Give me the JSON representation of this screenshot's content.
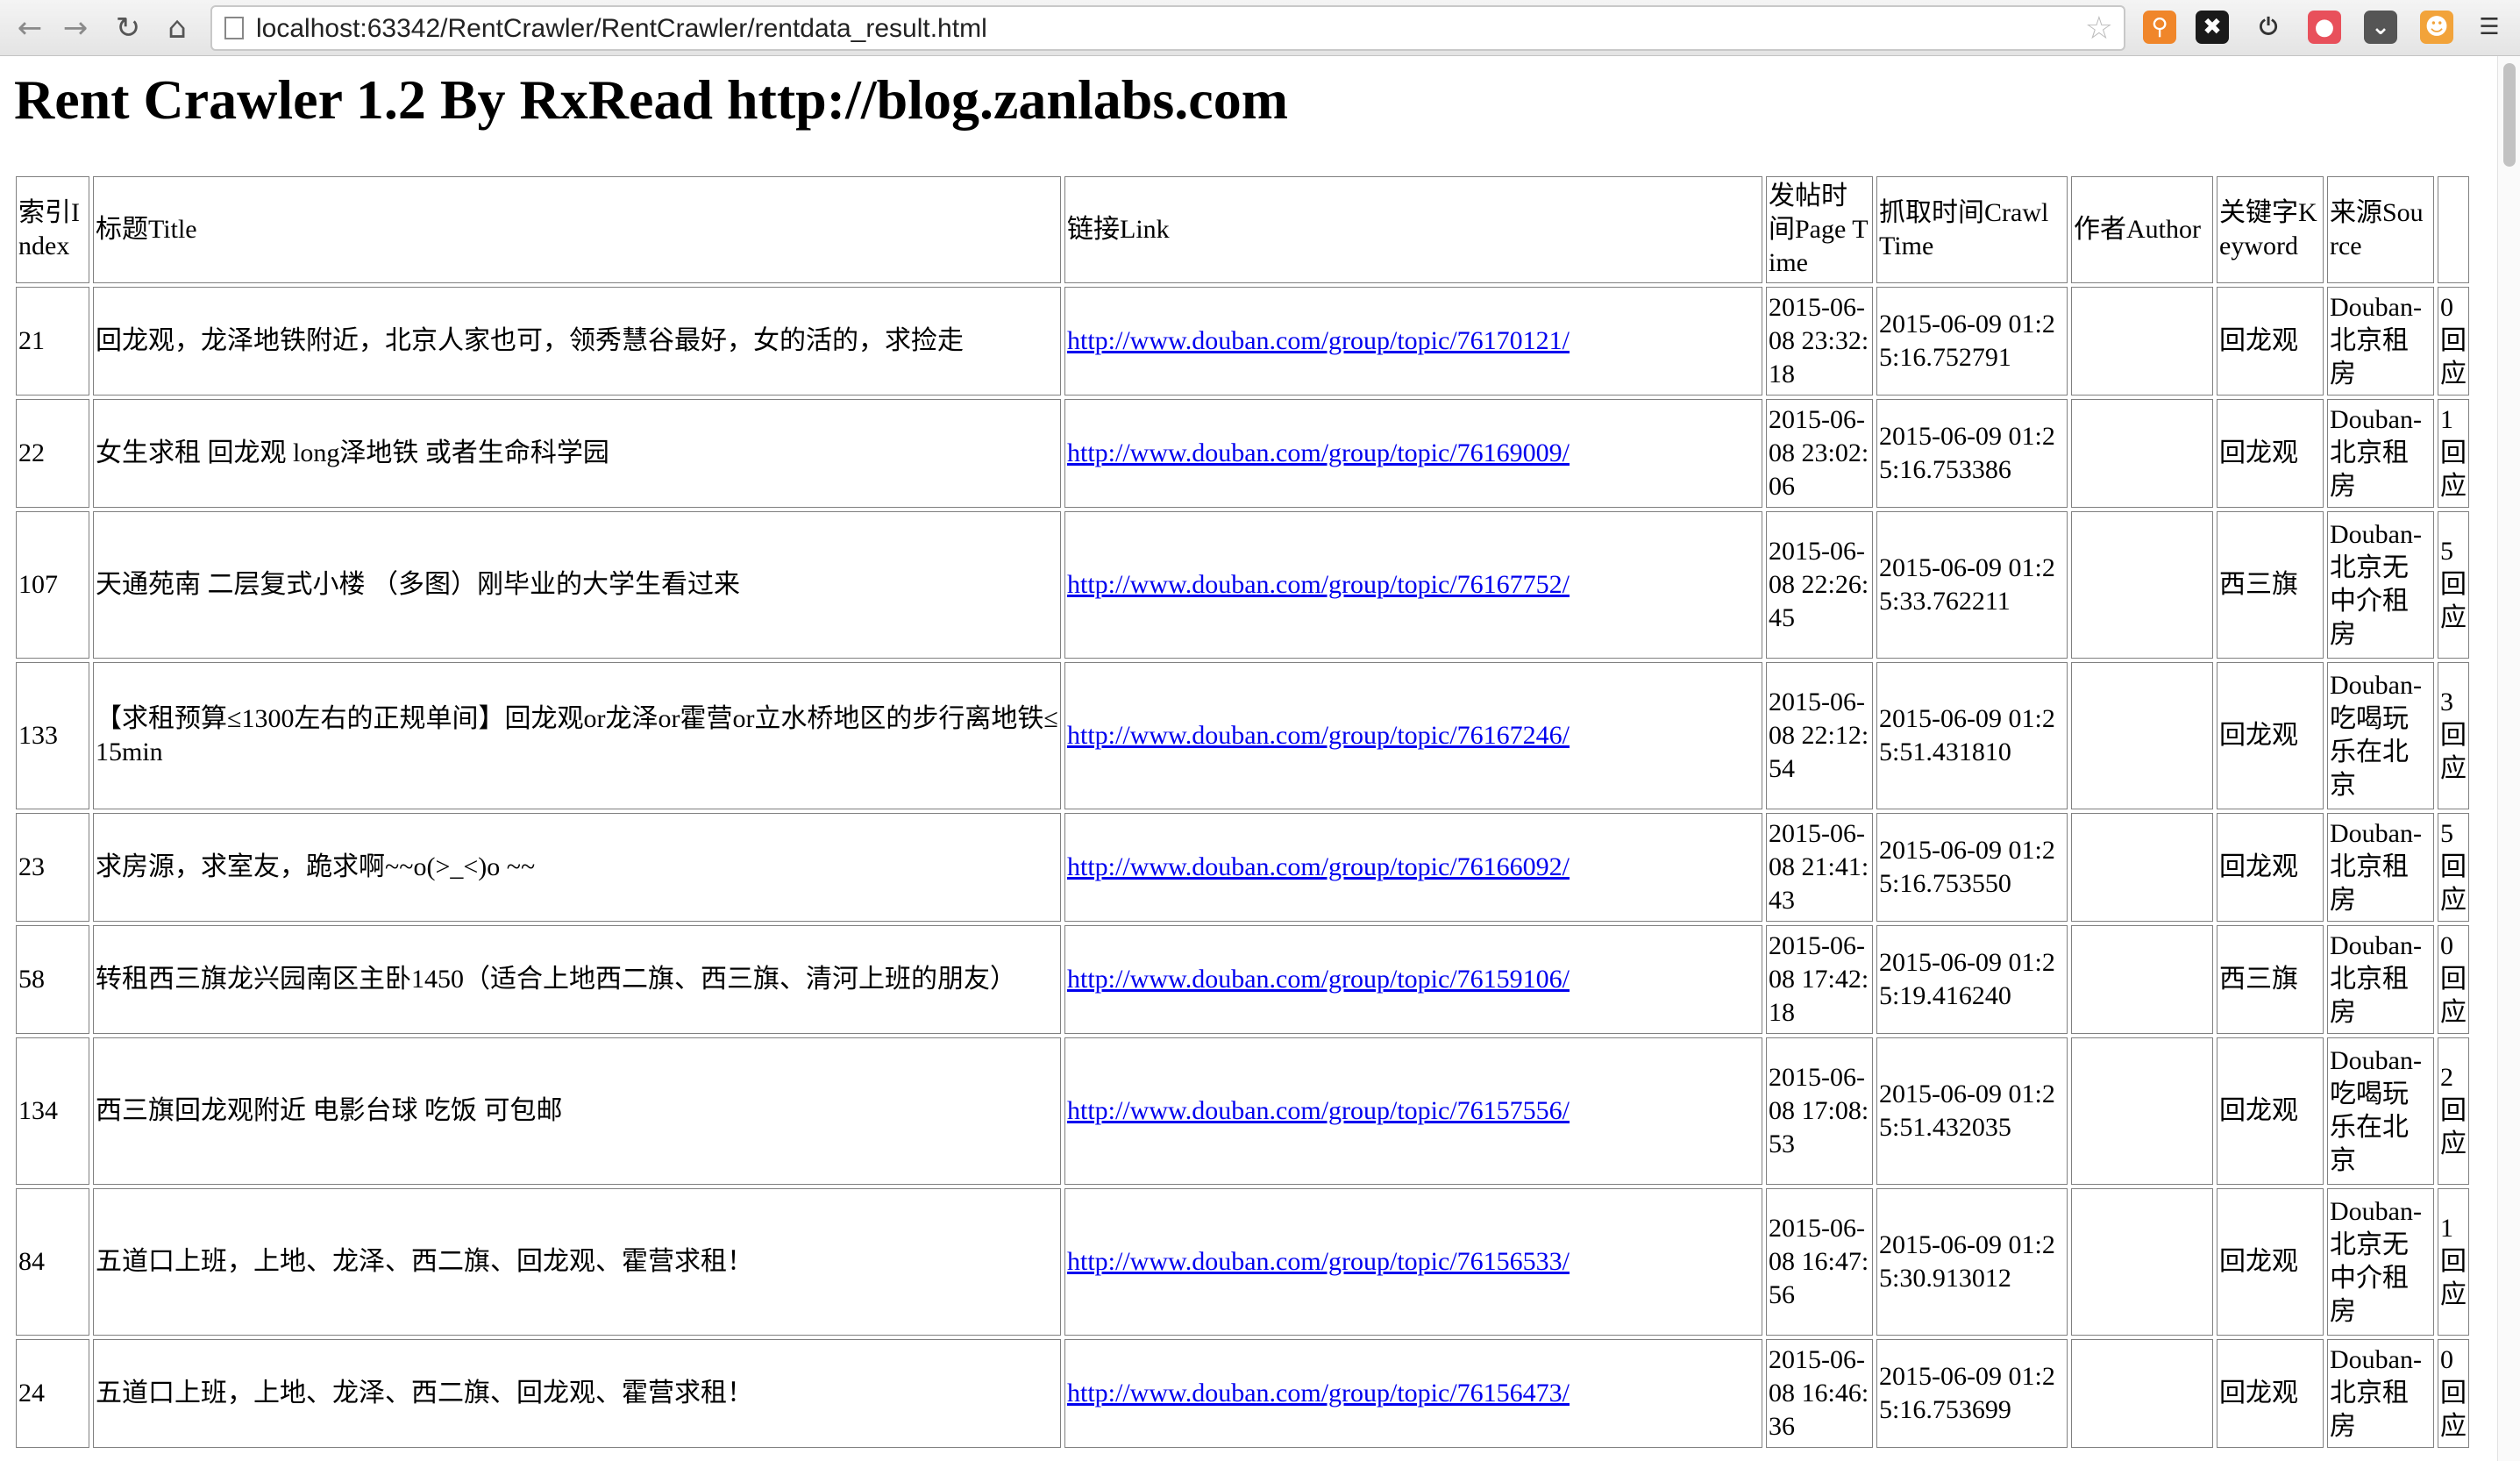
{
  "browser": {
    "url": "localhost:63342/RentCrawler/RentCrawler/rentdata_result.html",
    "extensions": [
      {
        "name": "extension-1-icon",
        "color": "#f0862a",
        "glyph": "⚲"
      },
      {
        "name": "extension-2-icon",
        "color": "#1a1a1a",
        "glyph": "✖"
      },
      {
        "name": "power-icon",
        "color": "#ffffff",
        "glyph": "⏻"
      },
      {
        "name": "extension-red-icon",
        "color": "#e8505b",
        "glyph": "●"
      },
      {
        "name": "pocket-icon",
        "color": "#555555",
        "glyph": "⌄"
      },
      {
        "name": "extension-face-icon",
        "color": "#f2a33a",
        "glyph": "☻"
      },
      {
        "name": "menu-icon",
        "color": "#ffffff",
        "glyph": "☰"
      }
    ]
  },
  "page": {
    "title": "Rent Crawler 1.2 By RxRead http://blog.zanlabs.com"
  },
  "table": {
    "headers": {
      "index": "索引Index",
      "title": "标题Title",
      "link": "链接Link",
      "page_time": "发帖时间Page Time",
      "crawl_time": "抓取时间Crawl Time",
      "author": "作者Author",
      "keyword": "关键字Keyword",
      "source": "来源Source",
      "replies": ""
    },
    "rows": [
      {
        "index": "21",
        "title": "回龙观，龙泽地铁附近，北京人家也可，领秀慧谷最好，女的活的，求捡走",
        "link": "http://www.douban.com/group/topic/76170121/",
        "page_time": "2015-06-08 23:32:18",
        "crawl_time": "2015-06-09 01:25:16.752791",
        "author": "",
        "keyword": "回龙观",
        "source": "Douban-北京租房",
        "replies": "0回应"
      },
      {
        "index": "22",
        "title": "女生求租 回龙观 long泽地铁 或者生命科学园",
        "link": "http://www.douban.com/group/topic/76169009/",
        "page_time": "2015-06-08 23:02:06",
        "crawl_time": "2015-06-09 01:25:16.753386",
        "author": "",
        "keyword": "回龙观",
        "source": "Douban-北京租房",
        "replies": "1回应"
      },
      {
        "index": "107",
        "title": "天通苑南 二层复式小楼 （多图）刚毕业的大学生看过来",
        "link": "http://www.douban.com/group/topic/76167752/",
        "page_time": "2015-06-08 22:26:45",
        "crawl_time": "2015-06-09 01:25:33.762211",
        "author": "",
        "keyword": "西三旗",
        "source": "Douban-北京无中介租房",
        "replies": "5回应"
      },
      {
        "index": "133",
        "title": "【求租预算≤1300左右的正规单间】回龙观or龙泽or霍营or立水桥地区的步行离地铁≤15min",
        "link": "http://www.douban.com/group/topic/76167246/",
        "page_time": "2015-06-08 22:12:54",
        "crawl_time": "2015-06-09 01:25:51.431810",
        "author": "",
        "keyword": "回龙观",
        "source": "Douban-吃喝玩乐在北京",
        "replies": "3回应"
      },
      {
        "index": "23",
        "title": "求房源，求室友，跪求啊~~o(>_<)o ~~",
        "link": "http://www.douban.com/group/topic/76166092/",
        "page_time": "2015-06-08 21:41:43",
        "crawl_time": "2015-06-09 01:25:16.753550",
        "author": "",
        "keyword": "回龙观",
        "source": "Douban-北京租房",
        "replies": "5回应"
      },
      {
        "index": "58",
        "title": "转租西三旗龙兴园南区主卧1450（适合上地西二旗、西三旗、清河上班的朋友）",
        "link": "http://www.douban.com/group/topic/76159106/",
        "page_time": "2015-06-08 17:42:18",
        "crawl_time": "2015-06-09 01:25:19.416240",
        "author": "",
        "keyword": "西三旗",
        "source": "Douban-北京租房",
        "replies": "0回应"
      },
      {
        "index": "134",
        "title": "西三旗回龙观附近 电影台球 吃饭 可包邮",
        "link": "http://www.douban.com/group/topic/76157556/",
        "page_time": "2015-06-08 17:08:53",
        "crawl_time": "2015-06-09 01:25:51.432035",
        "author": "",
        "keyword": "回龙观",
        "source": "Douban-吃喝玩乐在北京",
        "replies": "2回应"
      },
      {
        "index": "84",
        "title": "五道口上班，上地、龙泽、西二旗、回龙观、霍营求租！",
        "link": "http://www.douban.com/group/topic/76156533/",
        "page_time": "2015-06-08 16:47:56",
        "crawl_time": "2015-06-09 01:25:30.913012",
        "author": "",
        "keyword": "回龙观",
        "source": "Douban-北京无中介租房",
        "replies": "1回应"
      },
      {
        "index": "24",
        "title": "五道口上班，上地、龙泽、西二旗、回龙观、霍营求租！",
        "link": "http://www.douban.com/group/topic/76156473/",
        "page_time": "2015-06-08 16:46:36",
        "crawl_time": "2015-06-09 01:25:16.753699",
        "author": "",
        "keyword": "回龙观",
        "source": "Douban-北京租房",
        "replies": "0回应"
      }
    ]
  }
}
